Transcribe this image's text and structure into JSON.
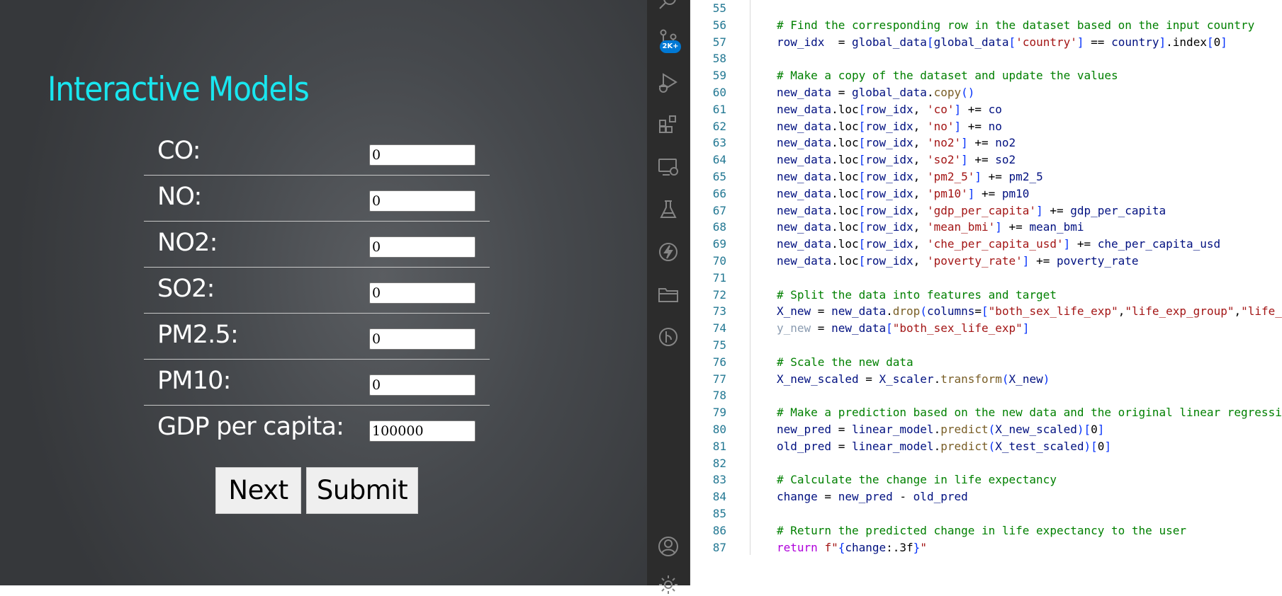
{
  "app": {
    "title": "Interactive Models",
    "fields": [
      {
        "label": "CO:",
        "value": "0"
      },
      {
        "label": "NO:",
        "value": "0"
      },
      {
        "label": "NO2:",
        "value": "0"
      },
      {
        "label": "SO2:",
        "value": "0"
      },
      {
        "label": "PM2.5:",
        "value": "0"
      },
      {
        "label": "PM10:",
        "value": "0"
      },
      {
        "label": "GDP per capita:",
        "value": "100000"
      }
    ],
    "buttons": {
      "next": "Next",
      "submit": "Submit"
    }
  },
  "activity_bar": {
    "icons": [
      "search-icon",
      "source-control-icon",
      "run-debug-icon",
      "extensions-icon",
      "remote-explorer-icon",
      "testing-icon",
      "lightning-icon",
      "folder-icon",
      "git-graph-icon",
      "account-icon",
      "settings-gear-icon"
    ],
    "source_control_badge": "2K+",
    "accent_color": "#0078d4"
  },
  "editor": {
    "line_numbers": [
      "55",
      "56",
      "57",
      "58",
      "59",
      "60",
      "61",
      "62",
      "63",
      "64",
      "65",
      "66",
      "67",
      "68",
      "69",
      "70",
      "71",
      "72",
      "73",
      "74",
      "75",
      "76",
      "77",
      "78",
      "79",
      "80",
      "81",
      "82",
      "83",
      "84",
      "85",
      "86",
      "87"
    ],
    "lines": [
      [],
      [
        [
          "cm",
          "# Find the corresponding row in the dataset based on the input country"
        ]
      ],
      [
        [
          "vr",
          "row_idx"
        ],
        [
          "",
          "  = "
        ],
        [
          "vr",
          "global_data"
        ],
        [
          "br",
          "["
        ],
        [
          "vr",
          "global_data"
        ],
        [
          "br",
          "["
        ],
        [
          "st",
          "'country'"
        ],
        [
          "br",
          "]"
        ],
        [
          "",
          ""
        ],
        [
          "",
          "",
          " "
        ],
        [
          "",
          "== "
        ],
        [
          "vr",
          "country"
        ],
        [
          "br",
          "]"
        ],
        [
          "",
          ".index"
        ],
        [
          "br",
          "["
        ],
        [
          "",
          "0"
        ],
        [
          "br",
          "]"
        ]
      ],
      [],
      [
        [
          "cm",
          "# Make a copy of the dataset and update the values"
        ]
      ],
      [
        [
          "vr",
          "new_data"
        ],
        [
          "",
          " = "
        ],
        [
          "vr",
          "global_data"
        ],
        [
          "",
          "."
        ],
        [
          "fn",
          "copy"
        ],
        [
          "br",
          "()"
        ]
      ],
      [
        [
          "vr",
          "new_data"
        ],
        [
          "",
          ".loc"
        ],
        [
          "br",
          "["
        ],
        [
          "vr",
          "row_idx"
        ],
        [
          "",
          ", "
        ],
        [
          "st",
          "'co'"
        ],
        [
          "br",
          "]"
        ],
        [
          "",
          " += "
        ],
        [
          "vr",
          "co"
        ]
      ],
      [
        [
          "vr",
          "new_data"
        ],
        [
          "",
          ".loc"
        ],
        [
          "br",
          "["
        ],
        [
          "vr",
          "row_idx"
        ],
        [
          "",
          ", "
        ],
        [
          "st",
          "'no'"
        ],
        [
          "br",
          "]"
        ],
        [
          "",
          " += "
        ],
        [
          "vr",
          "no"
        ]
      ],
      [
        [
          "vr",
          "new_data"
        ],
        [
          "",
          ".loc"
        ],
        [
          "br",
          "["
        ],
        [
          "vr",
          "row_idx"
        ],
        [
          "",
          ", "
        ],
        [
          "st",
          "'no2'"
        ],
        [
          "br",
          "]"
        ],
        [
          "",
          " += "
        ],
        [
          "vr",
          "no2"
        ]
      ],
      [
        [
          "vr",
          "new_data"
        ],
        [
          "",
          ".loc"
        ],
        [
          "br",
          "["
        ],
        [
          "vr",
          "row_idx"
        ],
        [
          "",
          ", "
        ],
        [
          "st",
          "'so2'"
        ],
        [
          "br",
          "]"
        ],
        [
          "",
          " += "
        ],
        [
          "vr",
          "so2"
        ]
      ],
      [
        [
          "vr",
          "new_data"
        ],
        [
          "",
          ".loc"
        ],
        [
          "br",
          "["
        ],
        [
          "vr",
          "row_idx"
        ],
        [
          "",
          ", "
        ],
        [
          "st",
          "'pm2_5'"
        ],
        [
          "br",
          "]"
        ],
        [
          "",
          " += "
        ],
        [
          "vr",
          "pm2_5"
        ]
      ],
      [
        [
          "vr",
          "new_data"
        ],
        [
          "",
          ".loc"
        ],
        [
          "br",
          "["
        ],
        [
          "vr",
          "row_idx"
        ],
        [
          "",
          ", "
        ],
        [
          "st",
          "'pm10'"
        ],
        [
          "br",
          "]"
        ],
        [
          "",
          " += "
        ],
        [
          "vr",
          "pm10"
        ]
      ],
      [
        [
          "vr",
          "new_data"
        ],
        [
          "",
          ".loc"
        ],
        [
          "br",
          "["
        ],
        [
          "vr",
          "row_idx"
        ],
        [
          "",
          ", "
        ],
        [
          "st",
          "'gdp_per_capita'"
        ],
        [
          "br",
          "]"
        ],
        [
          "",
          " += "
        ],
        [
          "vr",
          "gdp_per_capita"
        ]
      ],
      [
        [
          "vr",
          "new_data"
        ],
        [
          "",
          ".loc"
        ],
        [
          "br",
          "["
        ],
        [
          "vr",
          "row_idx"
        ],
        [
          "",
          ", "
        ],
        [
          "st",
          "'mean_bmi'"
        ],
        [
          "br",
          "]"
        ],
        [
          "",
          " += "
        ],
        [
          "vr",
          "mean_bmi"
        ]
      ],
      [
        [
          "vr",
          "new_data"
        ],
        [
          "",
          ".loc"
        ],
        [
          "br",
          "["
        ],
        [
          "vr",
          "row_idx"
        ],
        [
          "",
          ", "
        ],
        [
          "st",
          "'che_per_capita_usd'"
        ],
        [
          "br",
          "]"
        ],
        [
          "",
          " += "
        ],
        [
          "vr",
          "che_per_capita_usd"
        ]
      ],
      [
        [
          "vr",
          "new_data"
        ],
        [
          "",
          ".loc"
        ],
        [
          "br",
          "["
        ],
        [
          "vr",
          "row_idx"
        ],
        [
          "",
          ", "
        ],
        [
          "st",
          "'poverty_rate'"
        ],
        [
          "br",
          "]"
        ],
        [
          "",
          " += "
        ],
        [
          "vr",
          "poverty_rate"
        ]
      ],
      [],
      [
        [
          "cm",
          "# Split the data into features and target"
        ]
      ],
      [
        [
          "vr",
          "X_new"
        ],
        [
          "",
          " = "
        ],
        [
          "vr",
          "new_data"
        ],
        [
          "",
          "."
        ],
        [
          "fn",
          "drop"
        ],
        [
          "br",
          "("
        ],
        [
          "vr",
          "columns"
        ],
        [
          "",
          "="
        ],
        [
          "br",
          "["
        ],
        [
          "st",
          "\"both_sex_life_exp\""
        ],
        [
          "",
          ","
        ],
        [
          "st",
          "\"life_exp_group\""
        ],
        [
          "",
          ","
        ],
        [
          "st",
          "\"life_"
        ]
      ],
      [
        [
          "dim",
          "y_new"
        ],
        [
          "",
          " = "
        ],
        [
          "vr",
          "new_data"
        ],
        [
          "br",
          "["
        ],
        [
          "st",
          "\"both_sex_life_exp\""
        ],
        [
          "br",
          "]"
        ]
      ],
      [],
      [
        [
          "cm",
          "# Scale the new data"
        ]
      ],
      [
        [
          "vr",
          "X_new_scaled"
        ],
        [
          "",
          " = "
        ],
        [
          "vr",
          "X_scaler"
        ],
        [
          "",
          "."
        ],
        [
          "fn",
          "transform"
        ],
        [
          "br",
          "("
        ],
        [
          "vr",
          "X_new"
        ],
        [
          "br",
          ")"
        ]
      ],
      [],
      [
        [
          "cm",
          "# Make a prediction based on the new data and the original linear regressi"
        ]
      ],
      [
        [
          "vr",
          "new_pred"
        ],
        [
          "",
          " = "
        ],
        [
          "vr",
          "linear_model"
        ],
        [
          "",
          "."
        ],
        [
          "fn",
          "predict"
        ],
        [
          "br",
          "("
        ],
        [
          "vr",
          "X_new_scaled"
        ],
        [
          "br",
          ")"
        ],
        [
          "br",
          "["
        ],
        [
          "",
          "0"
        ],
        [
          "br",
          "]"
        ]
      ],
      [
        [
          "vr",
          "old_pred"
        ],
        [
          "",
          " = "
        ],
        [
          "vr",
          "linear_model"
        ],
        [
          "",
          "."
        ],
        [
          "fn",
          "predict"
        ],
        [
          "br",
          "("
        ],
        [
          "vr",
          "X_test_scaled"
        ],
        [
          "br",
          ")"
        ],
        [
          "br",
          "["
        ],
        [
          "",
          "0"
        ],
        [
          "br",
          "]"
        ]
      ],
      [],
      [
        [
          "cm",
          "# Calculate the change in life expectancy"
        ]
      ],
      [
        [
          "vr",
          "change"
        ],
        [
          "",
          " = "
        ],
        [
          "vr",
          "new_pred"
        ],
        [
          "",
          " - "
        ],
        [
          "vr",
          "old_pred"
        ]
      ],
      [],
      [
        [
          "cm",
          "# Return the predicted change in life expectancy to the user"
        ]
      ],
      [
        [
          "kw",
          "return"
        ],
        [
          "",
          " "
        ],
        [
          "st",
          "f\""
        ],
        [
          "br",
          "{"
        ],
        [
          "vr",
          "change"
        ],
        [
          "",
          ":.3f"
        ],
        [
          "br",
          "}"
        ],
        [
          "st",
          "\""
        ]
      ]
    ]
  }
}
